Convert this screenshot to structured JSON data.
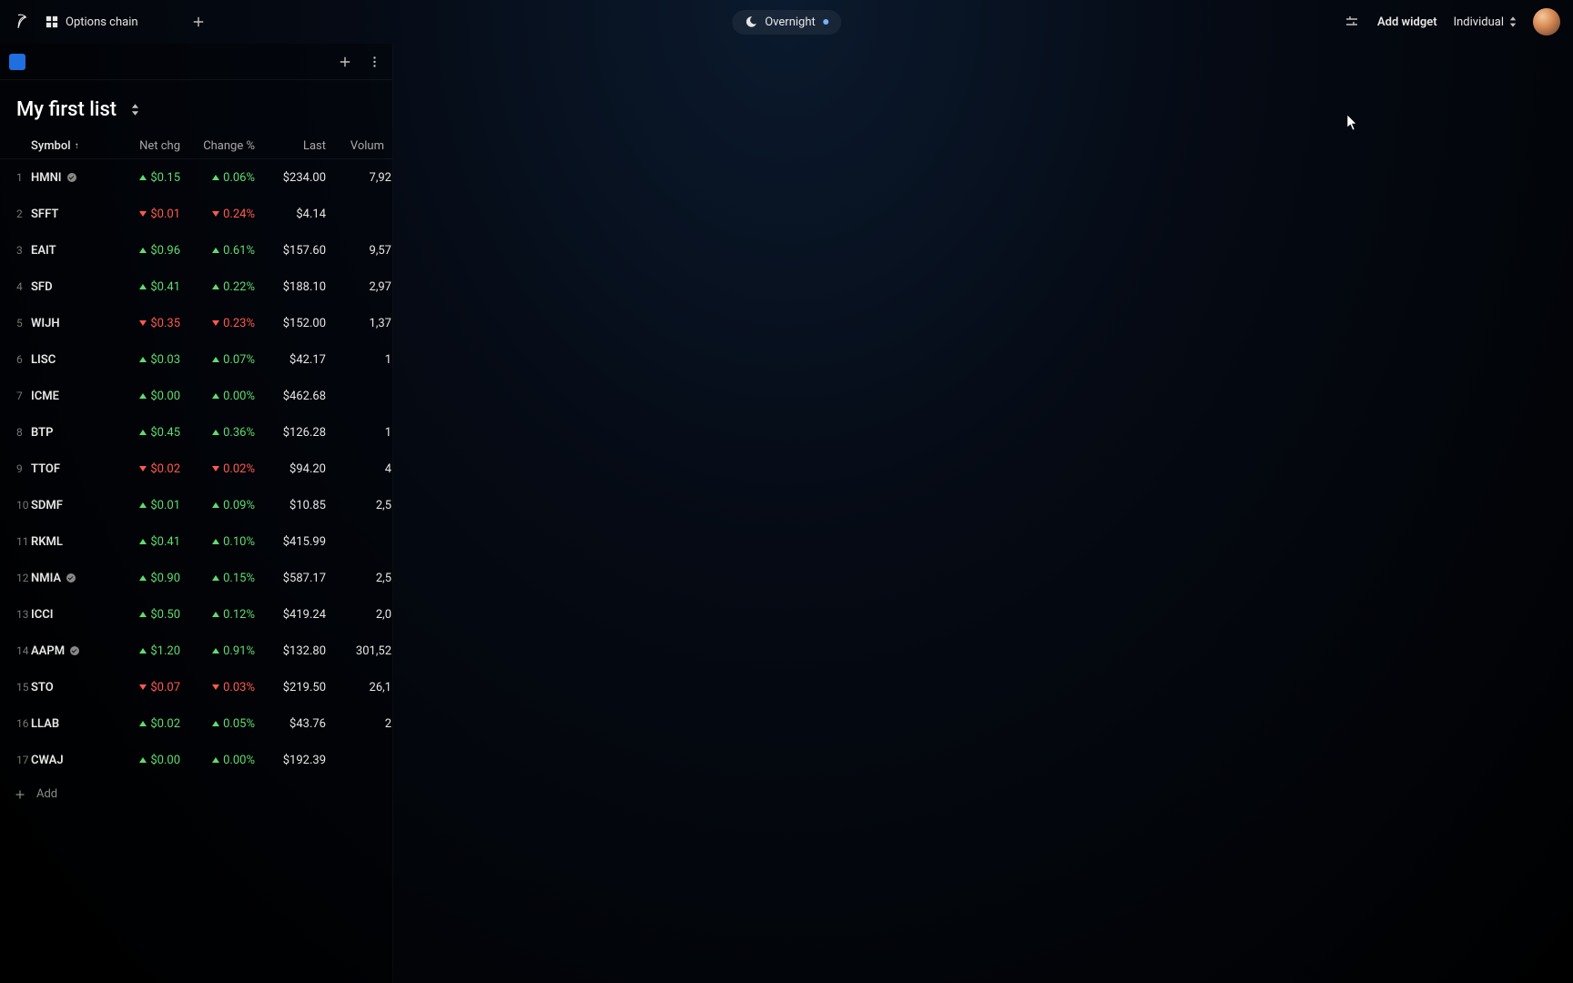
{
  "topbar": {
    "tab_label": "Options chain",
    "overnight_label": "Overnight",
    "add_widget_label": "Add widget",
    "account_label": "Individual"
  },
  "list": {
    "title": "My first list",
    "add_label": "Add",
    "columns": {
      "symbol": "Symbol",
      "netchg": "Net chg",
      "changepct": "Change %",
      "last": "Last",
      "volume": "Volum"
    },
    "rows": [
      {
        "idx": "1",
        "sym": "HMNI",
        "verified": true,
        "dir": "up",
        "netchg": "$0.15",
        "pct": "0.06%",
        "last": "$234.00",
        "vol": "7,92"
      },
      {
        "idx": "2",
        "sym": "SFFT",
        "verified": false,
        "dir": "down",
        "netchg": "$0.01",
        "pct": "0.24%",
        "last": "$4.14",
        "vol": ""
      },
      {
        "idx": "3",
        "sym": "EAIT",
        "verified": false,
        "dir": "up",
        "netchg": "$0.96",
        "pct": "0.61%",
        "last": "$157.60",
        "vol": "9,57"
      },
      {
        "idx": "4",
        "sym": "SFD",
        "verified": false,
        "dir": "up",
        "netchg": "$0.41",
        "pct": "0.22%",
        "last": "$188.10",
        "vol": "2,97"
      },
      {
        "idx": "5",
        "sym": "WIJH",
        "verified": false,
        "dir": "down",
        "netchg": "$0.35",
        "pct": "0.23%",
        "last": "$152.00",
        "vol": "1,37"
      },
      {
        "idx": "6",
        "sym": "LISC",
        "verified": false,
        "dir": "up",
        "netchg": "$0.03",
        "pct": "0.07%",
        "last": "$42.17",
        "vol": "1"
      },
      {
        "idx": "7",
        "sym": "ICME",
        "verified": false,
        "dir": "up",
        "netchg": "$0.00",
        "pct": "0.00%",
        "last": "$462.68",
        "vol": ""
      },
      {
        "idx": "8",
        "sym": "BTP",
        "verified": false,
        "dir": "up",
        "netchg": "$0.45",
        "pct": "0.36%",
        "last": "$126.28",
        "vol": "1"
      },
      {
        "idx": "9",
        "sym": "TTOF",
        "verified": false,
        "dir": "down",
        "netchg": "$0.02",
        "pct": "0.02%",
        "last": "$94.20",
        "vol": "4"
      },
      {
        "idx": "10",
        "sym": "SDMF",
        "verified": false,
        "dir": "up",
        "netchg": "$0.01",
        "pct": "0.09%",
        "last": "$10.85",
        "vol": "2,5"
      },
      {
        "idx": "11",
        "sym": "RKML",
        "verified": false,
        "dir": "up",
        "netchg": "$0.41",
        "pct": "0.10%",
        "last": "$415.99",
        "vol": ""
      },
      {
        "idx": "12",
        "sym": "NMIA",
        "verified": true,
        "dir": "up",
        "netchg": "$0.90",
        "pct": "0.15%",
        "last": "$587.17",
        "vol": "2,5"
      },
      {
        "idx": "13",
        "sym": "ICCI",
        "verified": false,
        "dir": "up",
        "netchg": "$0.50",
        "pct": "0.12%",
        "last": "$419.24",
        "vol": "2,0"
      },
      {
        "idx": "14",
        "sym": "AAPM",
        "verified": true,
        "dir": "up",
        "netchg": "$1.20",
        "pct": "0.91%",
        "last": "$132.80",
        "vol": "301,52"
      },
      {
        "idx": "15",
        "sym": "STO",
        "verified": false,
        "dir": "down",
        "netchg": "$0.07",
        "pct": "0.03%",
        "last": "$219.50",
        "vol": "26,1"
      },
      {
        "idx": "16",
        "sym": "LLAB",
        "verified": false,
        "dir": "up",
        "netchg": "$0.02",
        "pct": "0.05%",
        "last": "$43.76",
        "vol": "2"
      },
      {
        "idx": "17",
        "sym": "CWAJ",
        "verified": false,
        "dir": "up",
        "netchg": "$0.00",
        "pct": "0.00%",
        "last": "$192.39",
        "vol": ""
      }
    ]
  }
}
